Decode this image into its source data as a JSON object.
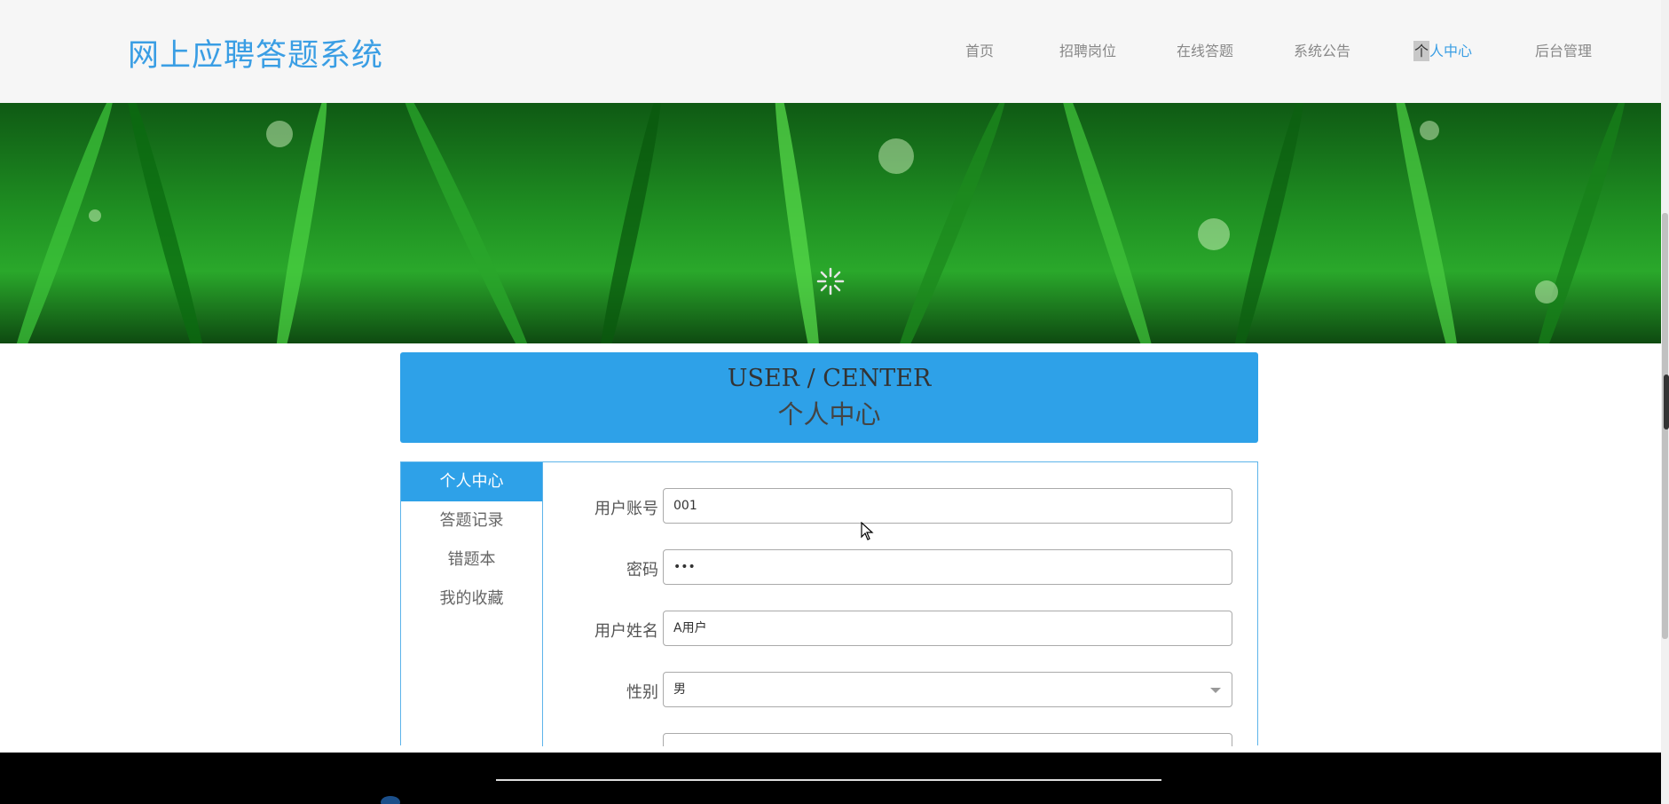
{
  "header": {
    "title": "网上应聘答题系统",
    "nav": [
      {
        "label": "首页",
        "active": false
      },
      {
        "label": "招聘岗位",
        "active": false
      },
      {
        "label": "在线答题",
        "active": false
      },
      {
        "label": "系统公告",
        "active": false
      },
      {
        "label_first": "个",
        "label_rest": "人中心",
        "active": true
      },
      {
        "label": "后台管理",
        "active": false
      }
    ]
  },
  "banner": {
    "description_icon": "loading-spinner-icon"
  },
  "titlebar": {
    "en": "USER / CENTER",
    "zh": "个人中心"
  },
  "sidebar": {
    "items": [
      {
        "label": "个人中心",
        "active": true
      },
      {
        "label": "答题记录",
        "active": false
      },
      {
        "label": "错题本",
        "active": false
      },
      {
        "label": "我的收藏",
        "active": false
      }
    ]
  },
  "form": {
    "account": {
      "label": "用户账号",
      "value": "001"
    },
    "password": {
      "label": "密码",
      "value": "•••"
    },
    "name": {
      "label": "用户姓名",
      "value": "A用户"
    },
    "gender": {
      "label": "性别",
      "value": "男"
    }
  },
  "colors": {
    "accent": "#2ea1e8",
    "brand": "#3a9ee4",
    "footer": "#000000"
  }
}
